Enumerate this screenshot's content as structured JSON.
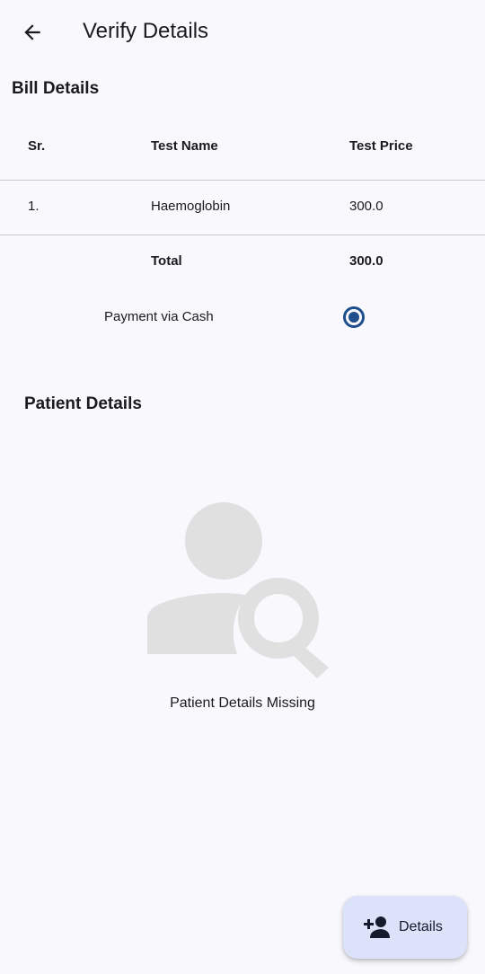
{
  "appbar": {
    "title": "Verify Details",
    "back_icon": "arrow-back-icon"
  },
  "bill": {
    "title": "Bill Details",
    "columns": [
      "Sr.",
      "Test Name",
      "Test Price"
    ],
    "rows": [
      {
        "sr": "1.",
        "name": "Haemoglobin",
        "price": "300.0"
      }
    ],
    "total_label": "Total",
    "total_value": "300.0",
    "payment_label": "Payment via Cash",
    "payment_selected": true
  },
  "patient": {
    "title": "Patient Details",
    "empty_icon": "person-search-icon",
    "empty_text": "Patient Details Missing"
  },
  "fab": {
    "label": "Details",
    "icon": "person-add-icon"
  },
  "colors": {
    "background": "#f8f8fd",
    "accent": "#1f4e8c",
    "fab_background": "#dbe2f9",
    "illustration": "#e0e0e0",
    "divider": "#c9c9cf"
  }
}
